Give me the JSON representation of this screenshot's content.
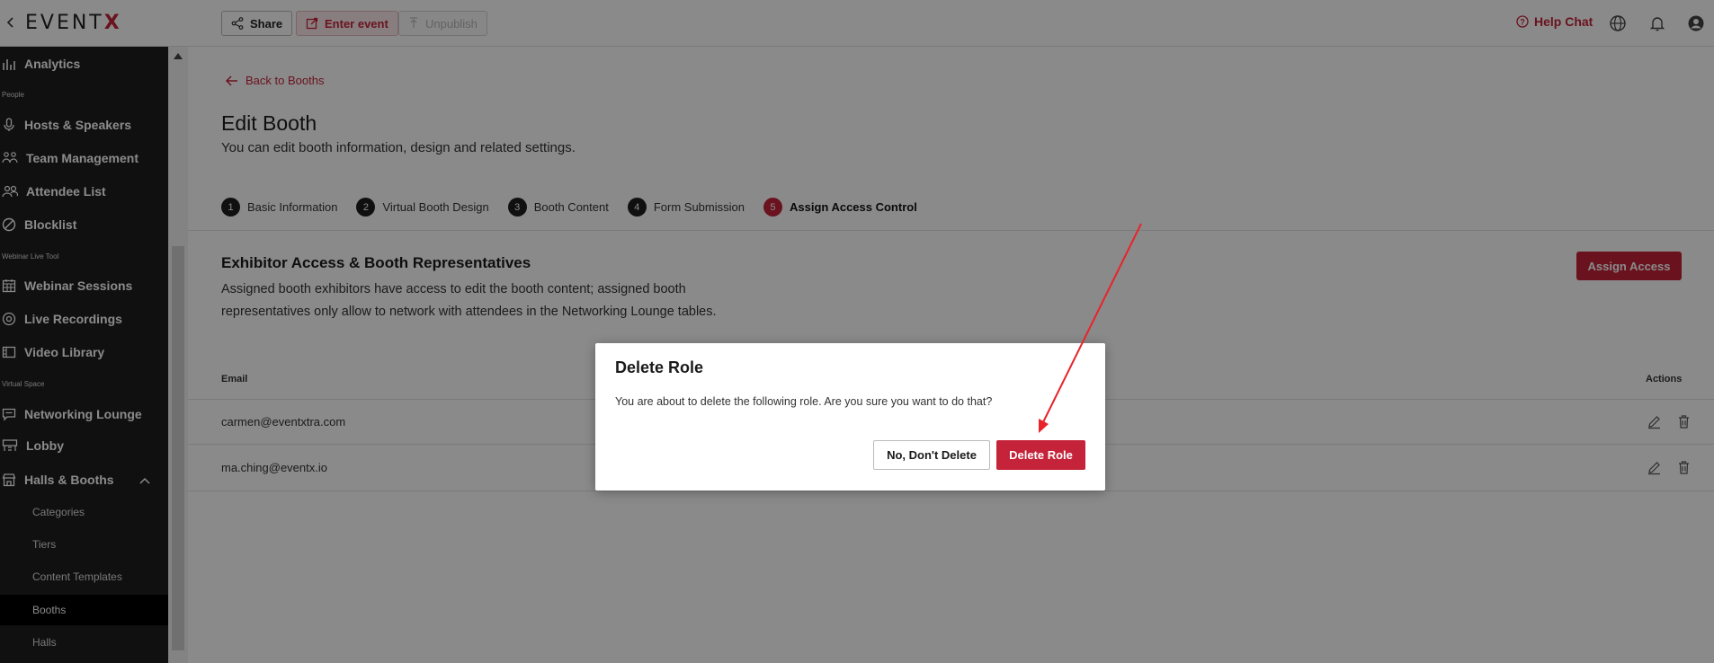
{
  "topbar": {
    "logo_text": "EVENT",
    "logo_x": "X",
    "share_label": "Share",
    "enter_label": "Enter event",
    "unpublish_label": "Unpublish",
    "help_chat_label": "Help Chat"
  },
  "sidebar": {
    "items": [
      {
        "label": "Analytics",
        "icon": "bar-chart-icon"
      },
      {
        "label": "Hosts & Speakers",
        "icon": "microphone-icon"
      },
      {
        "label": "Team Management",
        "icon": "team-icon"
      },
      {
        "label": "Attendee List",
        "icon": "people-icon"
      },
      {
        "label": "Blocklist",
        "icon": "block-icon"
      },
      {
        "label": "Webinar Sessions",
        "icon": "calendar-icon"
      },
      {
        "label": "Live Recordings",
        "icon": "record-icon"
      },
      {
        "label": "Video Library",
        "icon": "video-icon"
      },
      {
        "label": "Networking Lounge",
        "icon": "chat-icon"
      },
      {
        "label": "Lobby",
        "icon": "lobby-icon"
      },
      {
        "label": "Halls & Booths",
        "icon": "store-icon"
      }
    ],
    "sections": [
      "People",
      "Webinar Live Tool",
      "Virtual Space"
    ],
    "subitems": [
      "Categories",
      "Tiers",
      "Content Templates",
      "Booths",
      "Halls"
    ],
    "active_subitem": "Booths"
  },
  "main": {
    "back_label": "Back to Booths",
    "title": "Edit Booth",
    "subtitle": "You can edit booth information, design and related settings.",
    "steps": [
      {
        "num": "1",
        "label": "Basic Information"
      },
      {
        "num": "2",
        "label": "Virtual Booth Design"
      },
      {
        "num": "3",
        "label": "Booth Content"
      },
      {
        "num": "4",
        "label": "Form Submission"
      },
      {
        "num": "5",
        "label": "Assign Access Control"
      }
    ],
    "section_title": "Exhibitor Access & Booth Representatives",
    "section_desc": "Assigned booth exhibitors have access to edit the booth content; assigned booth representatives only allow to network with attendees in the Networking Lounge tables.",
    "assign_label": "Assign Access",
    "table_headers": {
      "email": "Email",
      "actions": "Actions"
    },
    "rows": [
      {
        "email": "carmen@eventxtra.com"
      },
      {
        "email": "ma.ching@eventx.io"
      }
    ]
  },
  "modal": {
    "title": "Delete Role",
    "body": "You are about to delete the following role. Are you sure you want to do that?",
    "cancel_label": "No, Don't Delete",
    "confirm_label": "Delete Role"
  },
  "colors": {
    "accent": "#c4233a",
    "sidebar_bg": "#1f1f1f",
    "annotation_arrow": "#e8232a"
  }
}
